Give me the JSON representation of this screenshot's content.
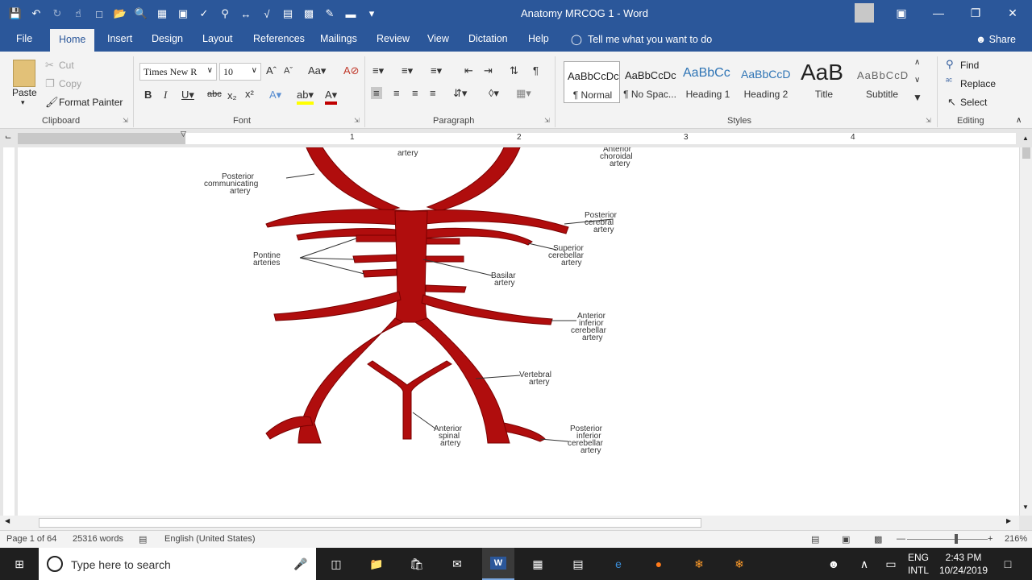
{
  "window": {
    "title": "Anatomy MRCOG 1  -  Word"
  },
  "tabs": [
    "File",
    "Home",
    "Insert",
    "Design",
    "Layout",
    "References",
    "Mailings",
    "Review",
    "View",
    "Dictation",
    "Help"
  ],
  "active_tab": "Home",
  "tell_me": "Tell me what you want to do",
  "share": "Share",
  "clipboard": {
    "paste": "Paste",
    "cut": "Cut",
    "copy": "Copy",
    "format_painter": "Format Painter",
    "label": "Clipboard"
  },
  "font": {
    "name": "Times New R",
    "size": "10",
    "label": "Font"
  },
  "paragraph": {
    "label": "Paragraph"
  },
  "styles": {
    "label": "Styles",
    "items": [
      {
        "preview": "AaBbCcDc",
        "name": "¶ Normal"
      },
      {
        "preview": "AaBbCcDc",
        "name": "¶ No Spac..."
      },
      {
        "preview": "AaBbCc",
        "name": "Heading 1"
      },
      {
        "preview": "AaBbCcD",
        "name": "Heading 2"
      },
      {
        "preview": "AaB",
        "name": "Title"
      },
      {
        "preview": "AaBbCcD",
        "name": "Subtitle"
      }
    ]
  },
  "editing": {
    "find": "Find",
    "replace": "Replace",
    "select": "Select",
    "label": "Editing"
  },
  "ruler": {
    "numbers": [
      "1",
      "2",
      "3",
      "4"
    ]
  },
  "diagram_labels": {
    "top_center": "artery",
    "top_right_1": "Anterior",
    "top_right_2": "choroidal",
    "top_right_3": "artery",
    "post_comm_1": "Posterior",
    "post_comm_2": "communicating",
    "post_comm_3": "artery",
    "post_cereb_1": "Posterior",
    "post_cereb_2": "cerebral",
    "post_cereb_3": "artery",
    "pontine_1": "Pontine",
    "pontine_2": "arteries",
    "sup_cereb_1": "Superior",
    "sup_cereb_2": "cerebellar",
    "sup_cereb_3": "artery",
    "basilar_1": "Basilar",
    "basilar_2": "artery",
    "ant_inf_1": "Anterior",
    "ant_inf_2": "inferior",
    "ant_inf_3": "cerebellar",
    "ant_inf_4": "artery",
    "vertebral_1": "Vertebral",
    "vertebral_2": "artery",
    "ant_spinal_1": "Anterior",
    "ant_spinal_2": "spinal",
    "ant_spinal_3": "artery",
    "post_inf_1": "Posterior",
    "post_inf_2": "inferior",
    "post_inf_3": "cerebellar",
    "post_inf_4": "artery"
  },
  "status": {
    "page": "Page 1 of 64",
    "words": "25316 words",
    "language": "English (United States)",
    "zoom": "216%"
  },
  "taskbar": {
    "search_placeholder": "Type here to search",
    "lang1": "ENG",
    "lang2": "INTL",
    "time": "2:43 PM",
    "date": "10/24/2019"
  },
  "colors": {
    "word_blue": "#2b579a",
    "artery_red": "#b00d0d"
  }
}
